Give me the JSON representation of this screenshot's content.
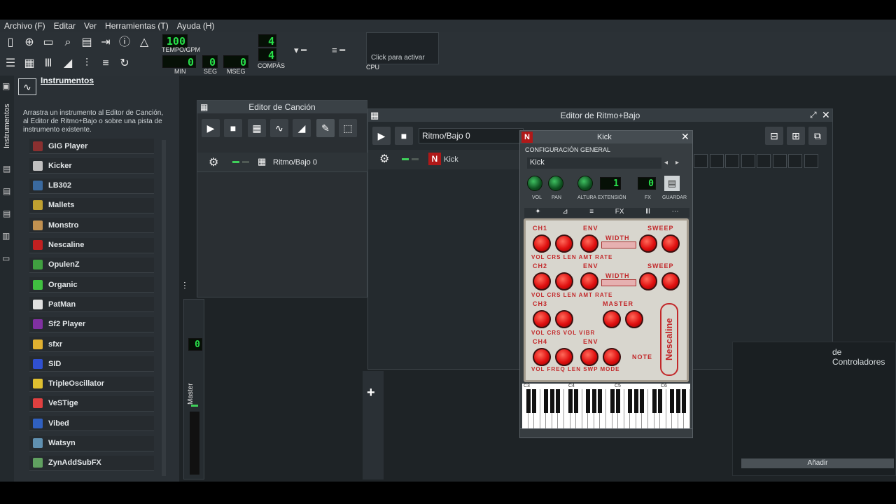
{
  "menu": [
    "Archivo (F)",
    "Editar",
    "Ver",
    "Herramientas (T)",
    "Ayuda (H)"
  ],
  "toolbar": {
    "tempo_value": "100",
    "tempo_label": "TEMPO/GPM",
    "min_value": "0",
    "seg_value": "0",
    "mseg_value": "0",
    "min_label": "MIN",
    "seg_label": "SEG",
    "mseg_label": "MSEG",
    "compas_top": "4",
    "compas_bottom": "4",
    "compas_label": "COMPÁS",
    "cpu_hint": "Click para activar",
    "cpu_label": "CPU"
  },
  "browser": {
    "title": "Instrumentos",
    "description": "Arrastra un instrumento al Editor de Canción, al Editor de Ritmo+Bajo o sobre una pista de instrumento existente.",
    "side_tab": "Instrumentos",
    "items": [
      {
        "label": "GIG Player",
        "color": "#8a3030"
      },
      {
        "label": "Kicker",
        "color": "#c0c0c0"
      },
      {
        "label": "LB302",
        "color": "#3a6aa0"
      },
      {
        "label": "Mallets",
        "color": "#c0a030"
      },
      {
        "label": "Monstro",
        "color": "#c09050"
      },
      {
        "label": "Nescaline",
        "color": "#c02020"
      },
      {
        "label": "OpulenZ",
        "color": "#40a040"
      },
      {
        "label": "Organic",
        "color": "#40c040"
      },
      {
        "label": "PatMan",
        "color": "#e0e0e0"
      },
      {
        "label": "Sf2 Player",
        "color": "#8030a0"
      },
      {
        "label": "sfxr",
        "color": "#e0b030"
      },
      {
        "label": "SID",
        "color": "#3050d0"
      },
      {
        "label": "TripleOscillator",
        "color": "#e0c030"
      },
      {
        "label": "VeSTige",
        "color": "#e04040"
      },
      {
        "label": "Vibed",
        "color": "#3060c0"
      },
      {
        "label": "Watsyn",
        "color": "#6090b0"
      },
      {
        "label": "ZynAddSubFX",
        "color": "#60a060"
      }
    ]
  },
  "song_editor": {
    "title": "Editor de Canción",
    "track_name": "Ritmo/Bajo 0"
  },
  "bb_editor": {
    "title": "Editor de Ritmo+Bajo",
    "pattern_select": "Ritmo/Bajo 0",
    "track_name": "Kick"
  },
  "plugin": {
    "title": "Kick",
    "section": "CONFIGURACIÓN GENERAL",
    "name_field": "Kick",
    "knob_labels": [
      "VOL",
      "PAN",
      "ALTURA",
      "EXTENSIÓN",
      "FX",
      "GUARDAR"
    ],
    "fx_value": "0",
    "ext_value": "1",
    "brand": "Nescaline",
    "rows": [
      {
        "ch": "CH1",
        "env": "ENV",
        "extra": "SWEEP",
        "labels": "VOL CRS LEN AMT RATE",
        "mid": "WIDTH"
      },
      {
        "ch": "CH2",
        "env": "ENV",
        "extra": "SWEEP",
        "labels": "VOL CRS LEN AMT RATE",
        "mid": "WIDTH"
      },
      {
        "ch": "CH3",
        "env": "",
        "extra": "MASTER",
        "labels": "VOL CRS VOL VIBR",
        "mid": ""
      },
      {
        "ch": "CH4",
        "env": "ENV",
        "extra": "NOTE",
        "labels": "VOL FREQ LEN SWP MODE",
        "mid": ""
      }
    ],
    "piano_labels": [
      "C3",
      "C4",
      "C5",
      "C6"
    ]
  },
  "controllers": {
    "title": "de Controladores",
    "add_button": "Añadir"
  },
  "mixer": {
    "label": "Master",
    "lcd_value": "0"
  }
}
